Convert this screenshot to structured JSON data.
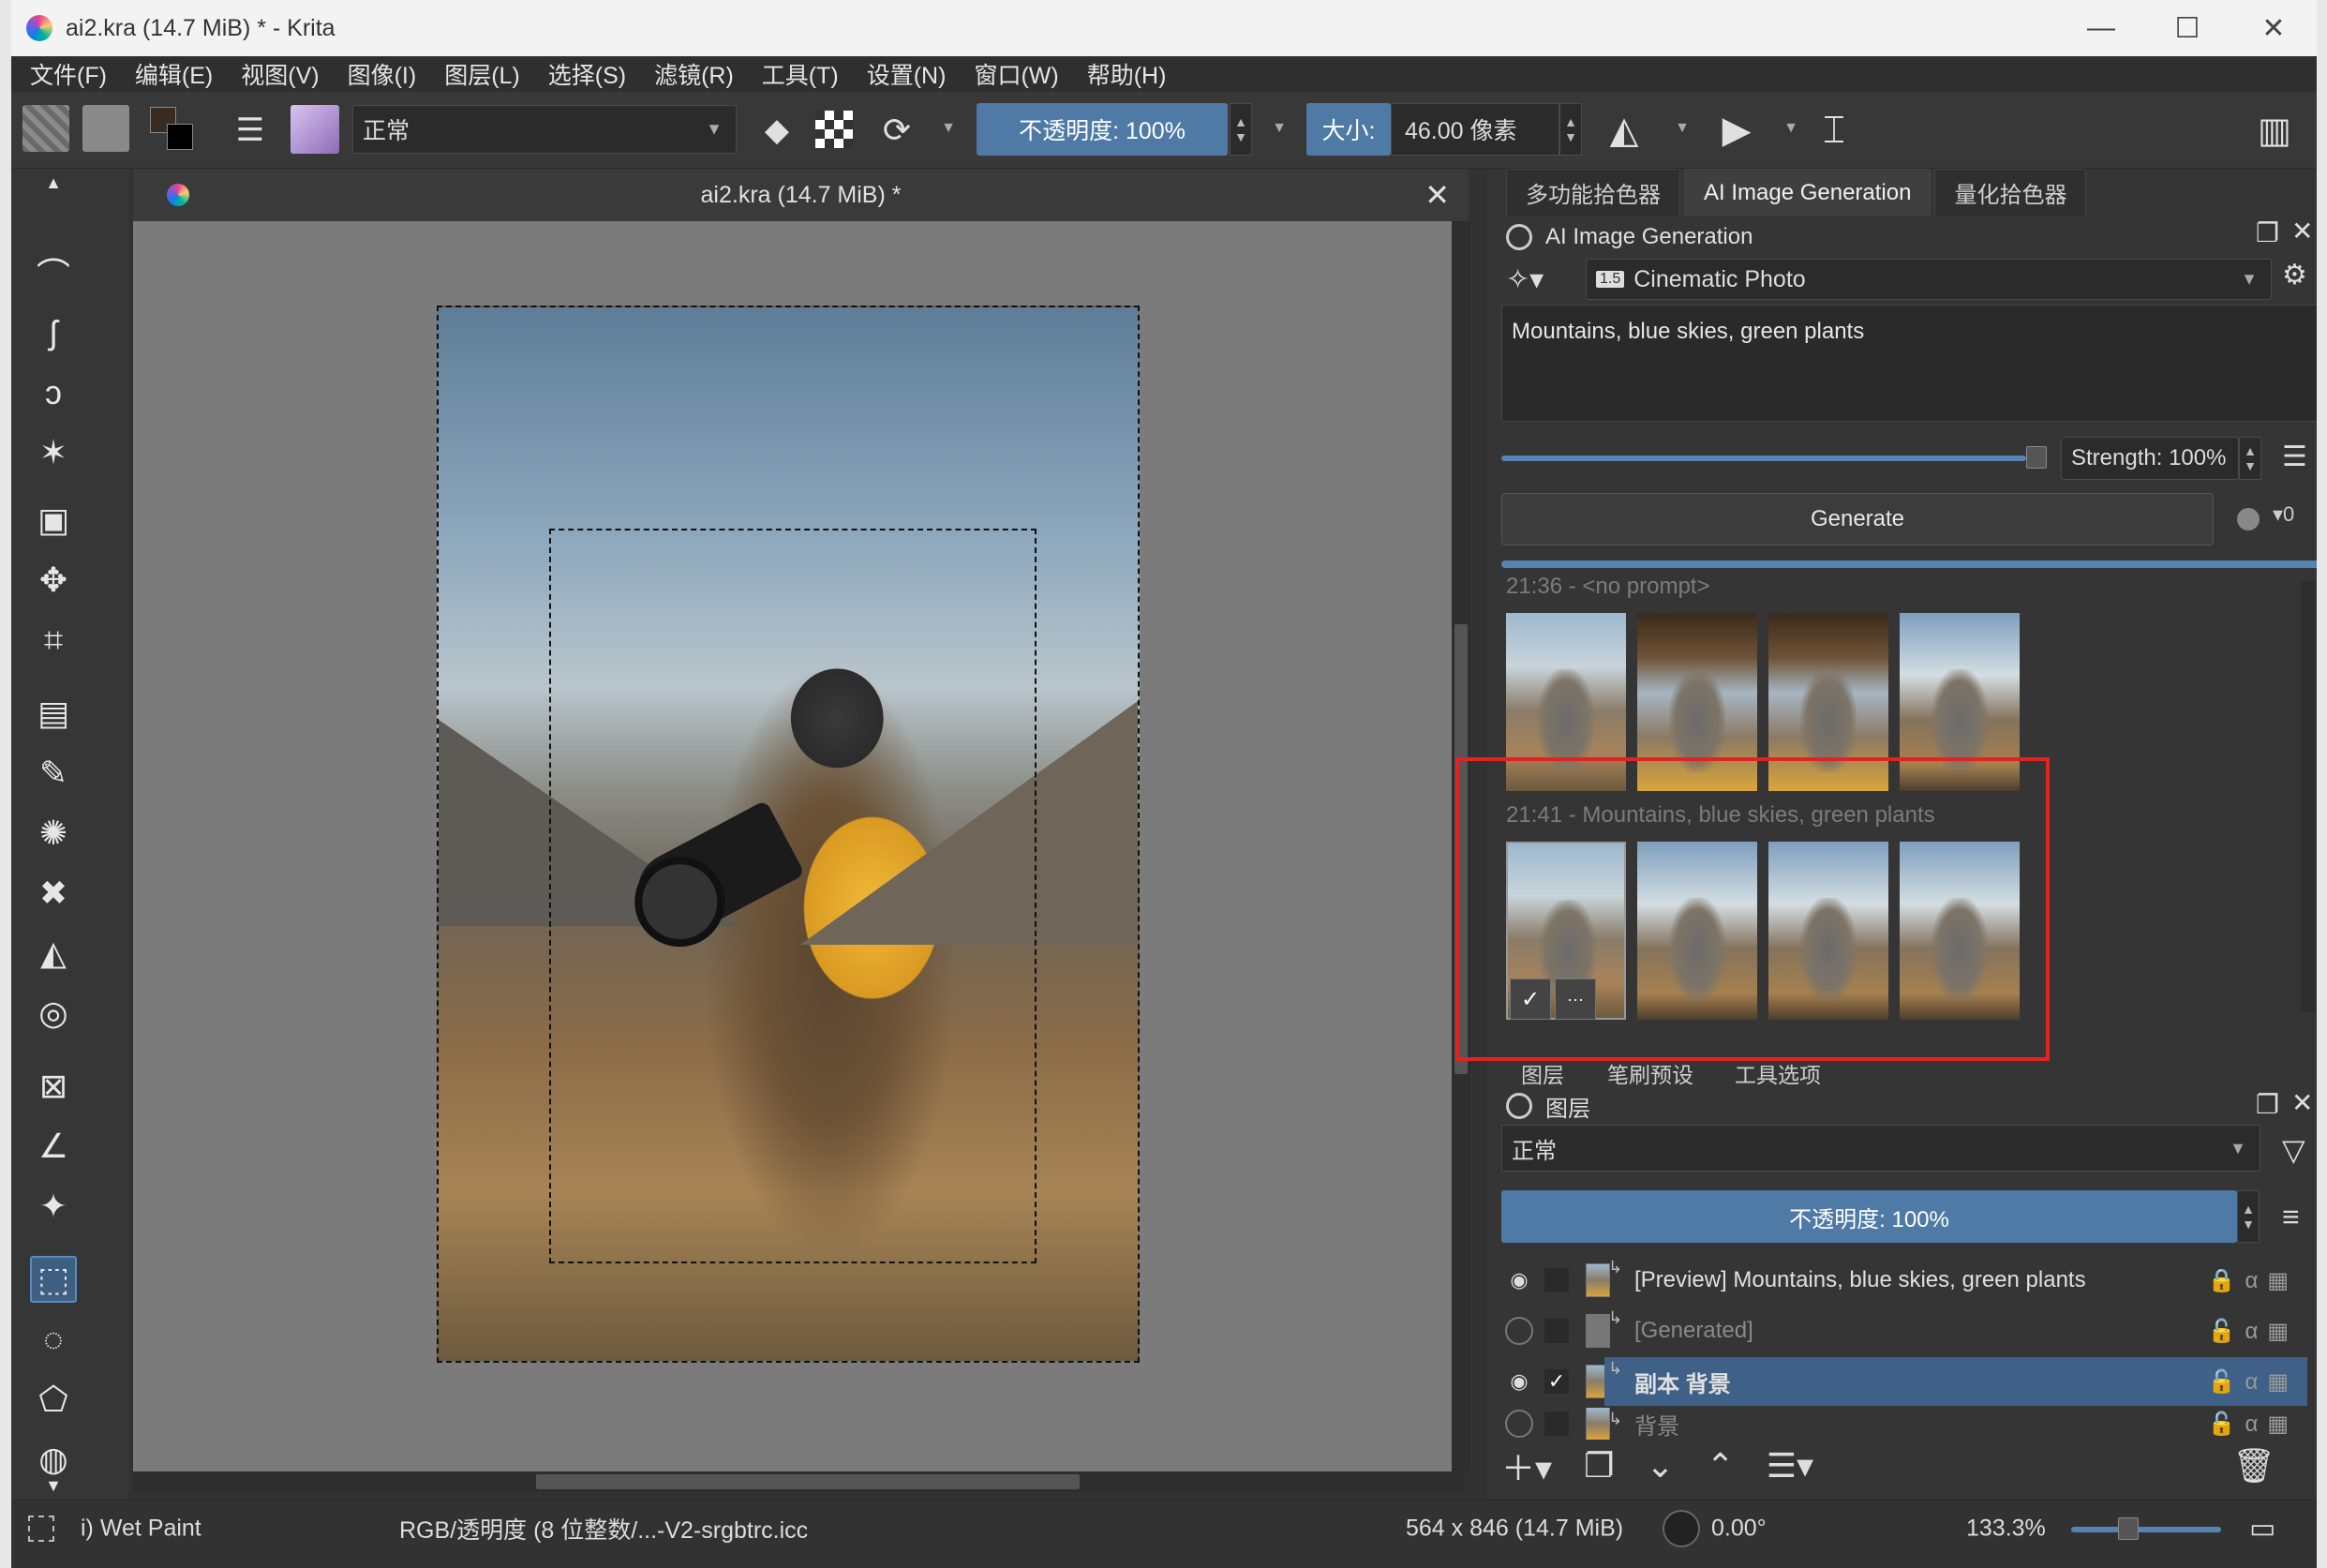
{
  "window": {
    "title": "ai2.kra (14.7 MiB) * - Krita",
    "minimize": "—",
    "maximize": "☐",
    "close": "✕"
  },
  "menu": [
    "文件(F)",
    "编辑(E)",
    "视图(V)",
    "图像(I)",
    "图层(L)",
    "选择(S)",
    "滤镜(R)",
    "工具(T)",
    "设置(N)",
    "窗口(W)",
    "帮助(H)"
  ],
  "toolbar": {
    "blend_mode": "正常",
    "opacity_label": "不透明度:  100%",
    "size_label": "大小:",
    "size_value": "46.00 像素"
  },
  "document": {
    "tab_title": "ai2.kra (14.7 MiB) *",
    "close": "✕"
  },
  "docker_tabs": [
    "多功能拾色器",
    "AI Image Generation",
    "量化拾色器"
  ],
  "ai_panel": {
    "title": "AI Image Generation",
    "style": "Cinematic Photo",
    "style_badge": "1.5",
    "prompt": "Mountains, blue skies, green plants",
    "strength": "Strength: 100%",
    "generate": "Generate",
    "queue_count": "0",
    "groups": [
      {
        "label": "21:36 - <no prompt>"
      },
      {
        "label": "21:41 - Mountains, blue skies, green plants"
      }
    ],
    "apply_icon": "✓",
    "more_icon": "···"
  },
  "sub_tabs": [
    "图层",
    "笔刷预设",
    "工具选项"
  ],
  "layers_panel": {
    "title": "图层",
    "blend_mode": "正常",
    "opacity": "不透明度:  100%",
    "layers": [
      {
        "name": "[Preview] Mountains, blue skies, green plants",
        "visible": true
      },
      {
        "name": "[Generated]",
        "visible": false
      },
      {
        "name": "副本 背景",
        "visible": true,
        "selected": true
      },
      {
        "name": "背景",
        "visible": false
      }
    ]
  },
  "statusbar": {
    "brush": "i) Wet Paint",
    "color_profile": "RGB/透明度 (8 位整数/...-V2-srgbtrc.icc",
    "dimensions": "564 x 846 (14.7 MiB)",
    "rotation": "0.00°",
    "zoom": "133.3%"
  },
  "colors": {
    "accent": "#4f7aa6",
    "highlight_box": "#e32222",
    "panel_bg": "#353535"
  }
}
